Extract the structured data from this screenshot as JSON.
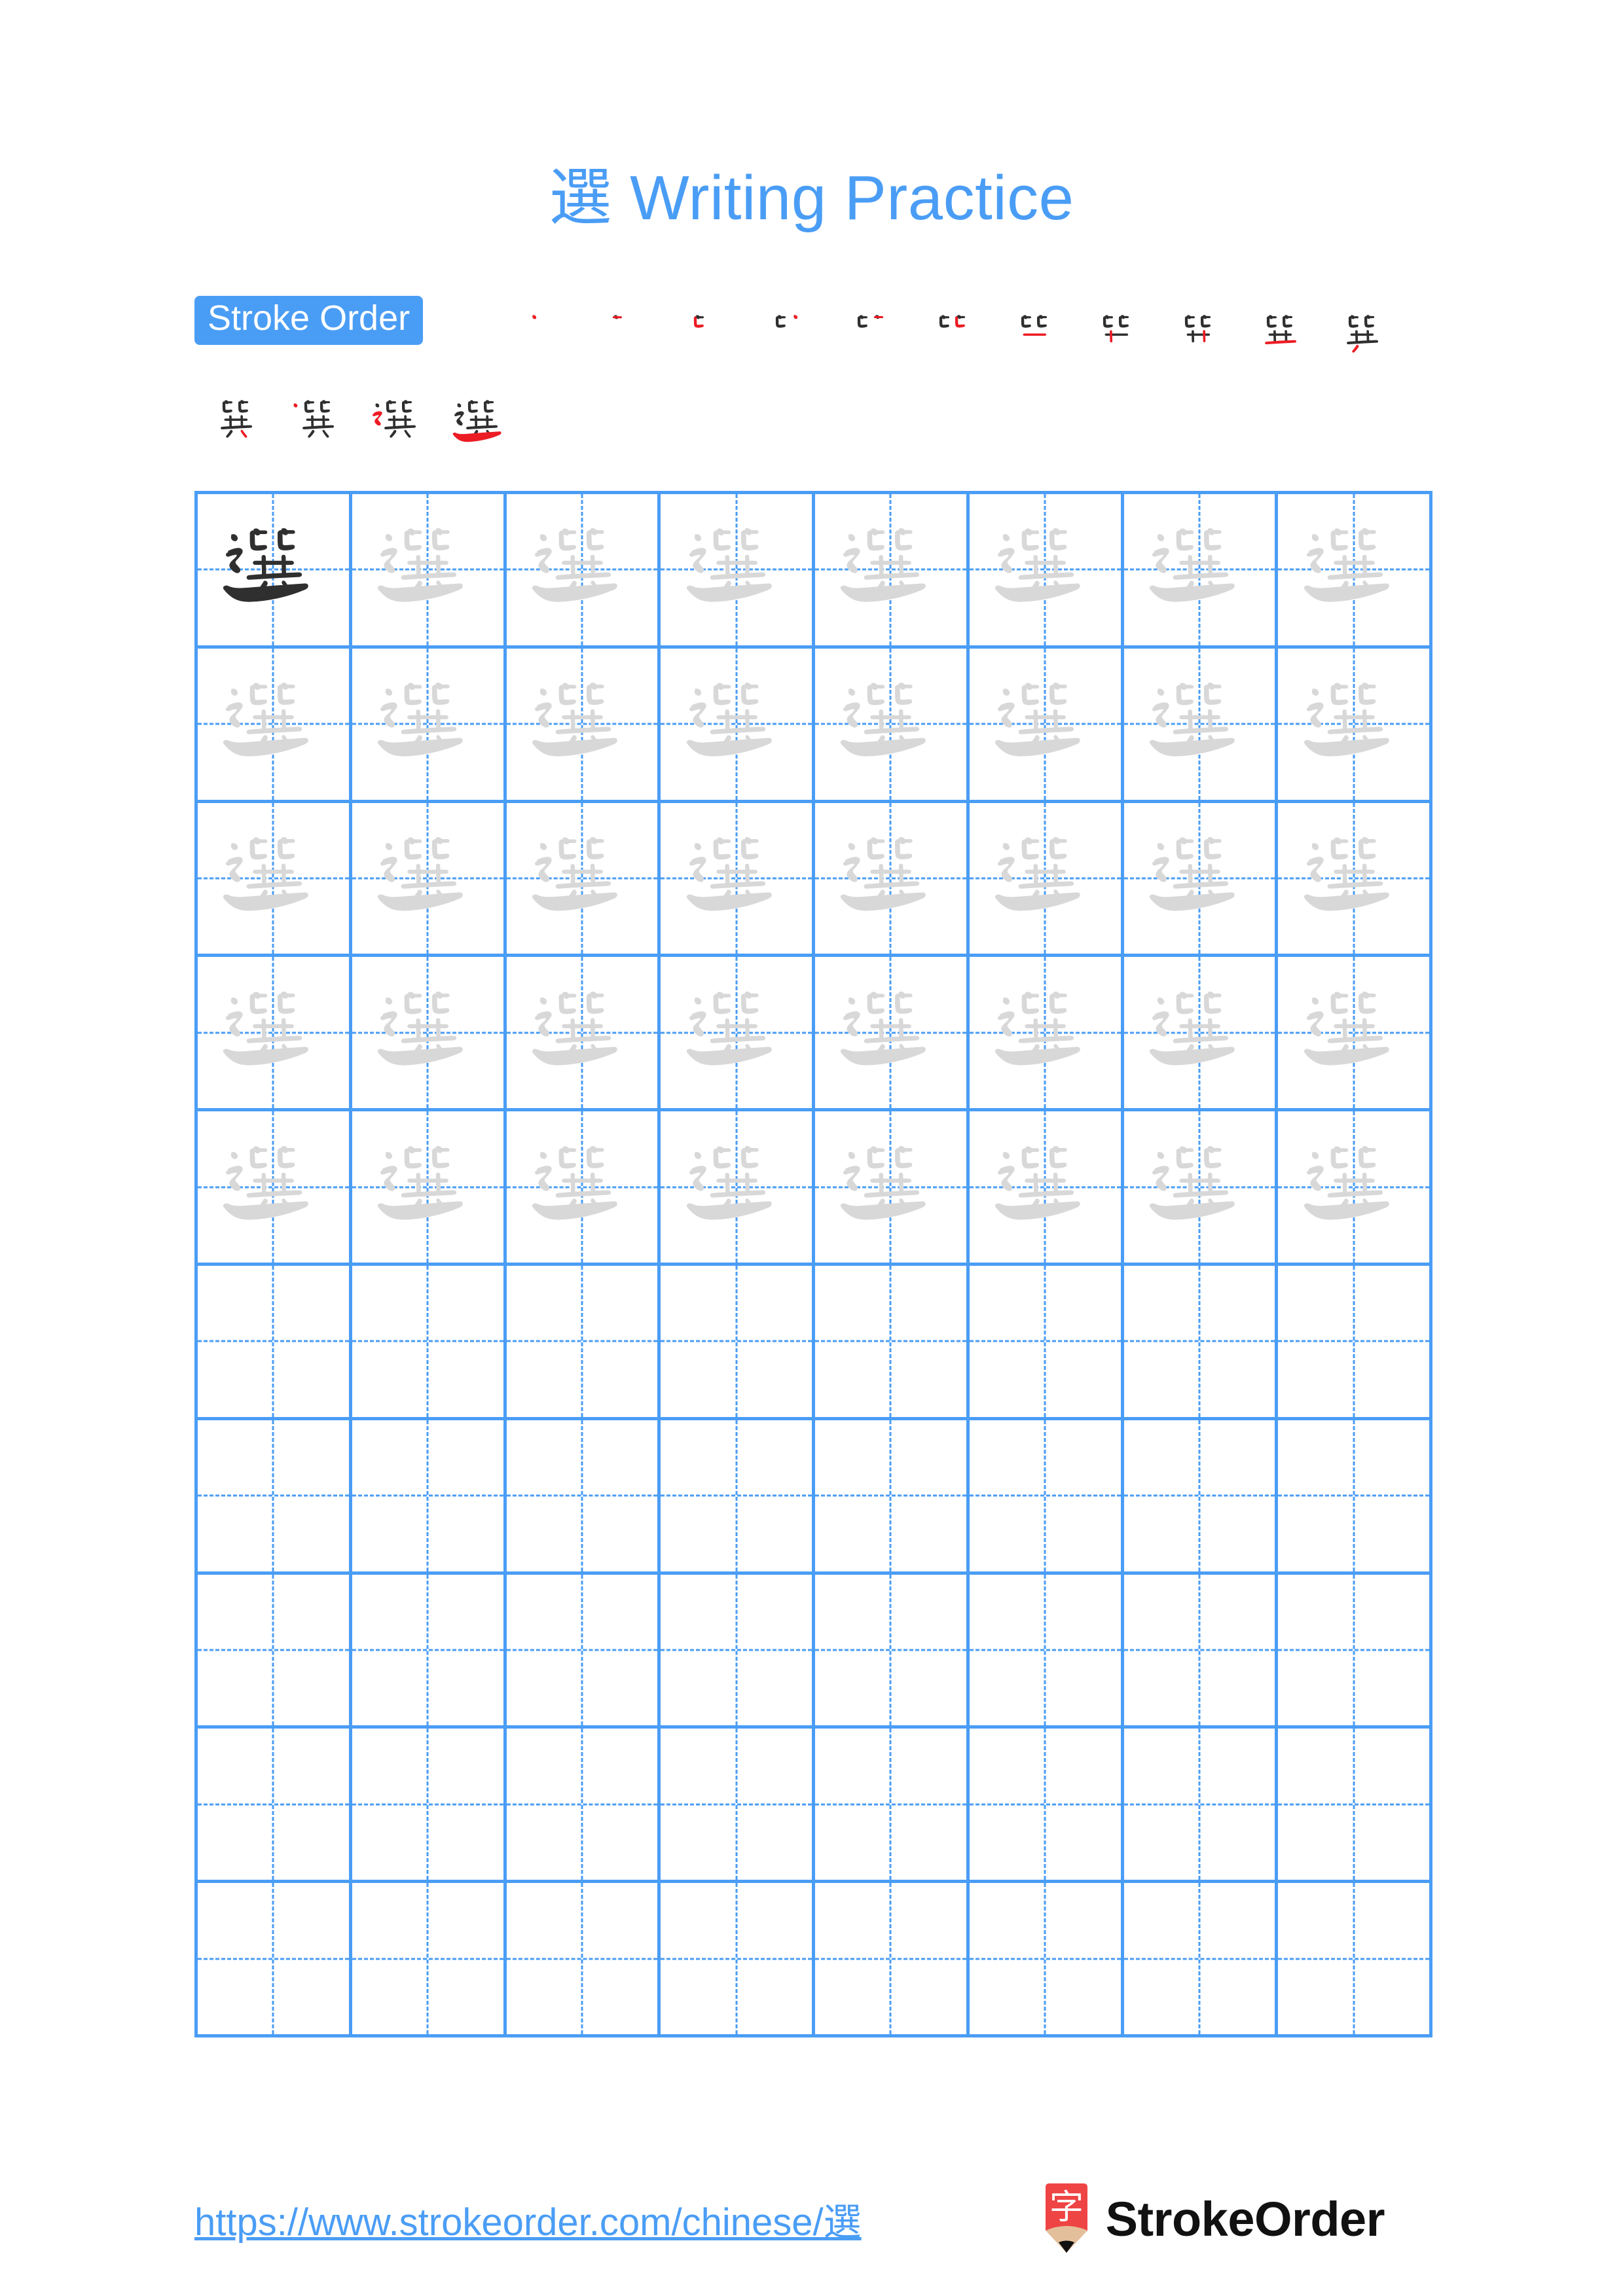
{
  "page": {
    "character": "選",
    "background_color": "#ffffff",
    "accent_color": "#4a9df5",
    "title": "選 Writing Practice"
  },
  "header": {
    "title_character": "選",
    "title_text": " Writing Practice"
  },
  "stroke_order": {
    "badge_label": "Stroke Order",
    "total_strokes": 15,
    "completed_color": "#2f2f2f",
    "new_stroke_color": "#ec1c24",
    "steps": [
      {
        "index": 1,
        "label": "stroke-1"
      },
      {
        "index": 2,
        "label": "stroke-2"
      },
      {
        "index": 3,
        "label": "stroke-3"
      },
      {
        "index": 4,
        "label": "stroke-4"
      },
      {
        "index": 5,
        "label": "stroke-5"
      },
      {
        "index": 6,
        "label": "stroke-6"
      },
      {
        "index": 7,
        "label": "stroke-7"
      },
      {
        "index": 8,
        "label": "stroke-8"
      },
      {
        "index": 9,
        "label": "stroke-9"
      },
      {
        "index": 10,
        "label": "stroke-10"
      },
      {
        "index": 11,
        "label": "stroke-11"
      },
      {
        "index": 12,
        "label": "stroke-12"
      },
      {
        "index": 13,
        "label": "stroke-13"
      },
      {
        "index": 14,
        "label": "stroke-14"
      },
      {
        "index": 15,
        "label": "stroke-15"
      }
    ]
  },
  "practice_grid": {
    "columns": 8,
    "rows": 10,
    "filled_rows": 5,
    "empty_rows": 5,
    "grid_line_color": "#4a9df5",
    "trace_color": "#d8d8d8",
    "model_color": "#2f2f2f",
    "model_cell_index": 0,
    "character": "選"
  },
  "footer": {
    "url": "https://www.strokeorder.com/chinese/選",
    "logo_character": "字",
    "logo_text": "StrokeOrder",
    "logo_body_color": "#ef4444",
    "logo_wood_color": "#e3c09b",
    "logo_tip_color": "#111111"
  }
}
